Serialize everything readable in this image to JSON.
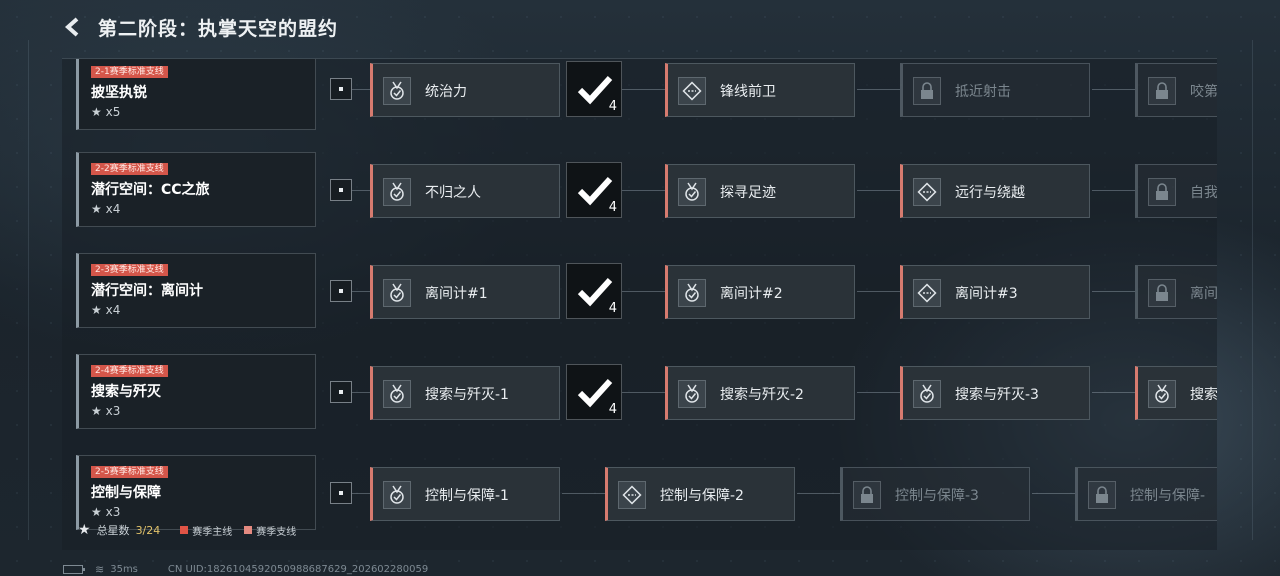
{
  "header": {
    "title": "第二阶段：执掌天空的盟约"
  },
  "rows": [
    {
      "tag": "2-1赛季标准支线",
      "title": "披坚执锐",
      "stars": "x5",
      "tasks": [
        "统治力",
        "锋线前卫",
        "抵近射击",
        "咬第"
      ],
      "check_count": "4"
    },
    {
      "tag": "2-2赛季标准支线",
      "title": "潜行空间：CC之旅",
      "stars": "x4",
      "tasks": [
        "不归之人",
        "探寻足迹",
        "远行与绕越",
        "自我"
      ],
      "check_count": "4"
    },
    {
      "tag": "2-3赛季标准支线",
      "title": "潜行空间：离间计",
      "stars": "x4",
      "tasks": [
        "离间计#1",
        "离间计#2",
        "离间计#3",
        "离间"
      ],
      "check_count": "4"
    },
    {
      "tag": "2-4赛季标准支线",
      "title": "搜索与歼灭",
      "stars": "x3",
      "tasks": [
        "搜索与歼灭-1",
        "搜索与歼灭-2",
        "搜索与歼灭-3",
        "搜索"
      ],
      "check_count": "4"
    },
    {
      "tag": "2-5赛季标准支线",
      "title": "控制与保障",
      "stars": "x3",
      "tasks": [
        "控制与保障-1",
        "控制与保障-2",
        "控制与保障-3",
        "控制与保障-"
      ]
    }
  ],
  "legend": {
    "total_label": "总星数",
    "total_value": "3/24",
    "main_line": "赛季主线",
    "side_line": "赛季支线"
  },
  "status": {
    "ping": "35ms",
    "uid": "CN UID:1826104592050988687629_202602280059"
  },
  "colors": {
    "accent": "#d77b6f",
    "tag": "#d4564a",
    "gold": "#e2c36a"
  },
  "icons": {
    "back": "chevron-left-icon",
    "medal": "medal-icon",
    "diamond": "diamond-icon",
    "lock": "lock-icon",
    "check": "checkmark-icon"
  }
}
